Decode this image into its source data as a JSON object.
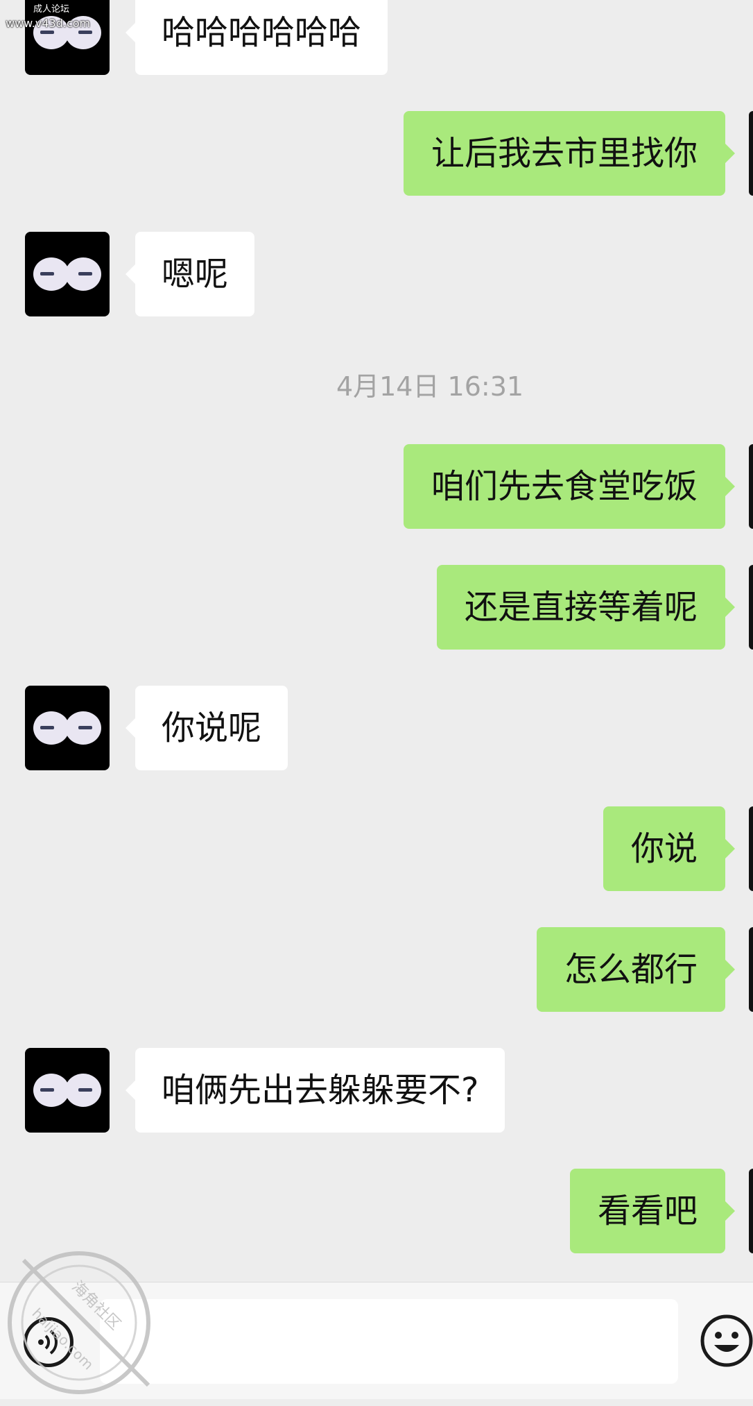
{
  "watermark": {
    "line1": "成人论坛",
    "line2": "www.v43d.com"
  },
  "messages": [
    {
      "side": "left",
      "text": "哈哈哈哈哈哈"
    },
    {
      "side": "right",
      "text": "让后我去市里找你"
    },
    {
      "side": "left",
      "text": "嗯呢"
    },
    {
      "side": "right",
      "text": "咱们先去食堂吃饭"
    },
    {
      "side": "right",
      "text": "还是直接等着呢"
    },
    {
      "side": "left",
      "text": "你说呢"
    },
    {
      "side": "right",
      "text": "你说"
    },
    {
      "side": "right",
      "text": "怎么都行"
    },
    {
      "side": "left",
      "text": "咱俩先出去躲躲要不?"
    },
    {
      "side": "right",
      "text": "看看吧"
    }
  ],
  "timestamp": "4月14日 16:31",
  "input_bar": {
    "voice_icon": "voice-icon",
    "emoji_icon": "emoji-icon",
    "input_value": ""
  },
  "stamp": {
    "text_cn": "海角社区",
    "text_en": "haijiao.com"
  },
  "colors": {
    "background": "#ededed",
    "self_bubble": "#a9e97c",
    "other_bubble": "#ffffff"
  }
}
